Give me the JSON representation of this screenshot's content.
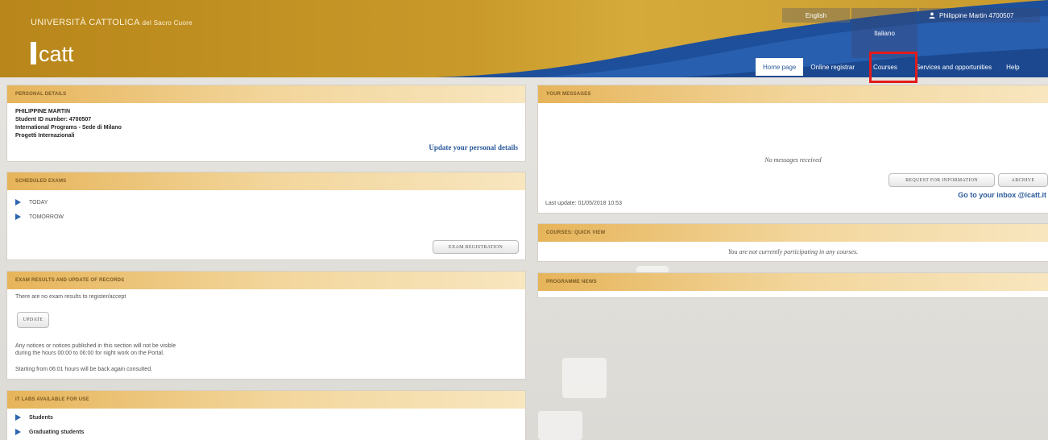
{
  "header": {
    "university_name": "UNIVERSITÀ CATTOLICA",
    "university_suffix": "del Sacro Cuore",
    "logo_text": "catt",
    "topbar": {
      "english": "English",
      "italiano": "Italiano",
      "user": "Philippine Martin 4700507"
    },
    "nav": [
      "Home page",
      "Online registrar",
      "Courses",
      "Services and opportunities",
      "Help"
    ]
  },
  "personal_details": {
    "title": "PERSONAL DETAILS",
    "name": "PHILIPPINE MARTIN",
    "student_id": "Student ID number: 4700507",
    "program": "International Programs - Sede di Milano",
    "unit": "Progetti Internazionali",
    "update_link": "Update your personal details"
  },
  "scheduled_exams": {
    "title": "SCHEDULED EXAMS",
    "items": [
      "TODAY",
      "TOMORROW"
    ],
    "button": "EXAM REGISTRATION"
  },
  "exam_results": {
    "title": "EXAM RESULTS AND UPDATE OF RECORDS",
    "text1": "There are no exam results to register/accept",
    "button": "UPDATE",
    "notice_line1": "Any notices or notices published in this section will not be visible",
    "notice_line2": "during the hours 00:00 to 06:00 for night work on the Portal.",
    "text3": "Starting from 06:01 hours will be back again consulted."
  },
  "it_labs": {
    "title": "IT LABS AVAILABLE FOR USE",
    "items": [
      "Students",
      "Graduating students"
    ]
  },
  "messages": {
    "title": "YOUR MESSAGES",
    "empty": "No messages received",
    "request_button": "REQUEST FOR INFORMATION",
    "archive_button": "ARCHIVE",
    "inbox_link": "Go to your inbox @icatt.it",
    "last_update": "Last update: 01/05/2018 10:53"
  },
  "courses_quick_view": {
    "title": "COURSES: QUICK VIEW",
    "empty": "You are not currently participating in any courses."
  },
  "programme_news": {
    "title": "PROGRAMME NEWS"
  },
  "colors": {
    "header_gold": "#c99a2a",
    "nav_blue": "#1e4f9a",
    "highlight_red": "#e21b1b",
    "link_blue": "#2a5a9a"
  }
}
